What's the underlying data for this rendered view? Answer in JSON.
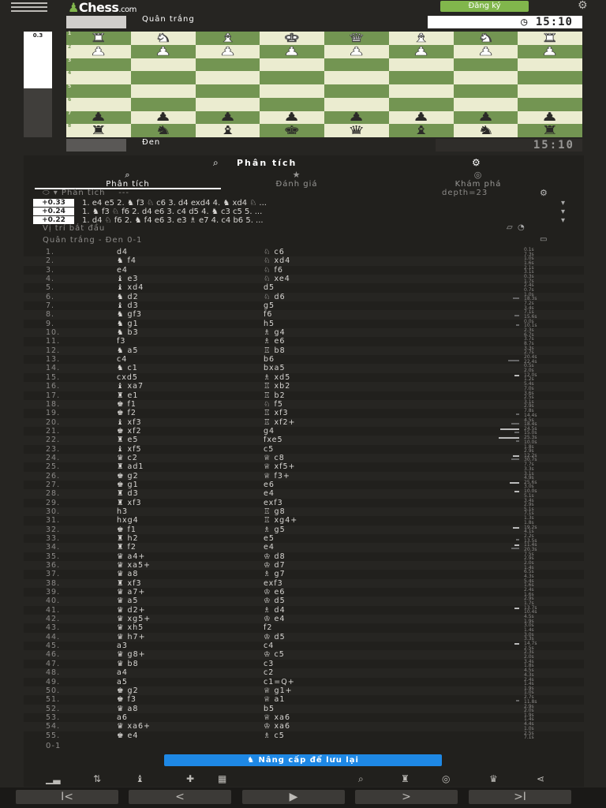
{
  "brand": {
    "logo": "Chess",
    "logo_suffix": ".com",
    "signup": "Đăng ký"
  },
  "eval_bar": {
    "value": "0.3",
    "white_fraction": 0.54
  },
  "players": {
    "top": {
      "name": "Quân trắng",
      "clock": "15:10"
    },
    "bottom": {
      "name": "Đen",
      "clock": "15:10"
    }
  },
  "board": {
    "ranks": [
      "1",
      "2",
      "3",
      "4",
      "5",
      "6",
      "7",
      "8"
    ],
    "rows": [
      [
        [
          "r",
          "w"
        ],
        [
          "n",
          "w"
        ],
        [
          "b",
          "w"
        ],
        [
          "k",
          "w"
        ],
        [
          "q",
          "w"
        ],
        [
          "b",
          "w"
        ],
        [
          "n",
          "w"
        ],
        [
          "r",
          "w"
        ]
      ],
      [
        [
          "p",
          "w"
        ],
        [
          "p",
          "w"
        ],
        [
          "p",
          "w"
        ],
        [
          "p",
          "w"
        ],
        [
          "p",
          "w"
        ],
        [
          "p",
          "w"
        ],
        [
          "p",
          "w"
        ],
        [
          "p",
          "w"
        ]
      ],
      [
        null,
        null,
        null,
        null,
        null,
        null,
        null,
        null
      ],
      [
        null,
        null,
        null,
        null,
        null,
        null,
        null,
        null
      ],
      [
        null,
        null,
        null,
        null,
        null,
        null,
        null,
        null
      ],
      [
        null,
        null,
        null,
        null,
        null,
        null,
        null,
        null
      ],
      [
        [
          "p",
          "b"
        ],
        [
          "p",
          "b"
        ],
        [
          "p",
          "b"
        ],
        [
          "p",
          "b"
        ],
        [
          "p",
          "b"
        ],
        [
          "p",
          "b"
        ],
        [
          "p",
          "b"
        ],
        [
          "p",
          "b"
        ]
      ],
      [
        [
          "r",
          "b"
        ],
        [
          "n",
          "b"
        ],
        [
          "b",
          "b"
        ],
        [
          "k",
          "b"
        ],
        [
          "q",
          "b"
        ],
        [
          "b",
          "b"
        ],
        [
          "n",
          "b"
        ],
        [
          "r",
          "b"
        ]
      ]
    ]
  },
  "panel": {
    "title": "Phân tích",
    "tabs": [
      {
        "label": "Phân tích",
        "icon": "⌕"
      },
      {
        "label": "Đánh giá",
        "icon": "★"
      },
      {
        "label": "Khám phá",
        "icon": "◎"
      }
    ],
    "analysis_label": "Phân tích",
    "analysis_extra": "---",
    "depth": "depth=23",
    "lines": [
      {
        "eval": "+0.33",
        "text": "1. e4 e5 2. ♞ f3 ♘ c6 3. d4 exd4 4. ♞ xd4 ♘ ..."
      },
      {
        "eval": "+0.24",
        "text": "1. ♞ f3 ♘ f6 2. d4 e6 3. c4 d5 4. ♞ c3 c5 5. ..."
      },
      {
        "eval": "+0.22",
        "text": "1. d4 ♘ f6 2. ♞ f4 e6 3. e3 ♗ e7 4. c4 b6 5. ..."
      }
    ],
    "start_position": "Vị trí bắt đầu",
    "game_header": "Quân trắng - Đen 0-1",
    "result": "0-1",
    "upgrade": "Nâng cấp để lưu lại"
  },
  "moves": [
    {
      "n": "1.",
      "w": "d4",
      "b": "♘ c6",
      "t1": "0.1s",
      "t2": "7.3s",
      "bw": 0,
      "bb": 0
    },
    {
      "n": "2.",
      "w": "♞ f4",
      "b": "♘ xd4",
      "t1": "1.0s",
      "t2": "1.6s",
      "bw": 0,
      "bb": 0
    },
    {
      "n": "3.",
      "w": "e4",
      "b": "♘ f6",
      "t1": "2.1s",
      "t2": "3.1s",
      "bw": 0,
      "bb": 0
    },
    {
      "n": "4.",
      "w": "♝ e3",
      "b": "♘ xe4",
      "t1": "0.3s",
      "t2": "1.7s",
      "bw": 0,
      "bb": 0
    },
    {
      "n": "5.",
      "w": "♝ xd4",
      "b": "d5",
      "t1": "2.4s",
      "t2": "0.7s",
      "bw": 0,
      "bb": 0
    },
    {
      "n": "6.",
      "w": "♞ d2",
      "b": "♘ d6",
      "t1": "1.0s",
      "t2": "18.3s",
      "bw": 0,
      "bb": 8
    },
    {
      "n": "7.",
      "w": "♝ d3",
      "b": "g5",
      "t1": "7.2s",
      "t2": "3.4s",
      "bw": 0,
      "bb": 0
    },
    {
      "n": "8.",
      "w": "♞ gf3",
      "b": "f6",
      "t1": "7.1s",
      "t2": "15.6s",
      "bw": 0,
      "bb": 6
    },
    {
      "n": "9.",
      "w": "♞ g1",
      "b": "h5",
      "t1": "0.0s",
      "t2": "10.1s",
      "bw": 0,
      "bb": 4
    },
    {
      "n": "10.",
      "w": "♞ b3",
      "b": "♗ g4",
      "t1": "2.3s",
      "t2": "6.7s",
      "bw": 0,
      "bb": 0
    },
    {
      "n": "11.",
      "w": "f3",
      "b": "♗ e6",
      "t1": "3.7s",
      "t2": "8.7s",
      "bw": 0,
      "bb": 0
    },
    {
      "n": "12.",
      "w": "♞ a5",
      "b": "♖ b8",
      "t1": "3.3s",
      "t2": "2.7s",
      "bw": 0,
      "bb": 0
    },
    {
      "n": "13.",
      "w": "c4",
      "b": "b6",
      "t1": "20.4s",
      "t2": "22.4s",
      "bw": 0,
      "bb": 14
    },
    {
      "n": "14.",
      "w": "♞ c1",
      "b": "bxa5",
      "t1": "0.5s",
      "t2": "2.0s",
      "bw": 0,
      "bb": 0
    },
    {
      "n": "15.",
      "w": "cxd5",
      "b": "♗ xd5",
      "t1": "12.0s",
      "t2": "1.2s",
      "bw": 6,
      "bb": 0
    },
    {
      "n": "16.",
      "w": "♝ xa7",
      "b": "♖ xb2",
      "t1": "5.4s",
      "t2": "7.0s",
      "bw": 0,
      "bb": 0
    },
    {
      "n": "17.",
      "w": "♜ e1",
      "b": "♖ b2",
      "t1": "3.6s",
      "t2": "2.5s",
      "bw": 0,
      "bb": 0
    },
    {
      "n": "18.",
      "w": "♚ f1",
      "b": "♘ f5",
      "t1": "3.1s",
      "t2": "2.9s",
      "bw": 0,
      "bb": 0
    },
    {
      "n": "19.",
      "w": "♚ f2",
      "b": "♖ xf3",
      "t1": "7.8s",
      "t2": "14.4s",
      "bw": 0,
      "bb": 4
    },
    {
      "n": "20.",
      "w": "♝ xf3",
      "b": "♖ xf2+",
      "t1": "4.5s",
      "t2": "18.4s",
      "bw": 0,
      "bb": 10
    },
    {
      "n": "21.",
      "w": "♚ xf2",
      "b": "g4",
      "t1": "24.5s",
      "t2": "15.0s",
      "bw": 24,
      "bb": 6
    },
    {
      "n": "22.",
      "w": "♜ e5",
      "b": "fxe5",
      "t1": "25.3s",
      "t2": "10.0s",
      "bw": 26,
      "bb": 4
    },
    {
      "n": "23.",
      "w": "♝ xf5",
      "b": "c5",
      "t1": "1.8s",
      "t2": "2.9s",
      "bw": 0,
      "bb": 0
    },
    {
      "n": "24.",
      "w": "♛ c2",
      "b": "♕ c8",
      "t1": "12.2s",
      "t2": "30.7s",
      "bw": 8,
      "bb": 10
    },
    {
      "n": "25.",
      "w": "♜ ad1",
      "b": "♕ xf5+",
      "t1": "7.7s",
      "t2": "3.3s",
      "bw": 0,
      "bb": 0
    },
    {
      "n": "26.",
      "w": "♚ g2",
      "b": "♕ f3+",
      "t1": "3.1s",
      "t2": "4.9s",
      "bw": 0,
      "bb": 0
    },
    {
      "n": "27.",
      "w": "♚ g1",
      "b": "e6",
      "t1": "25.6s",
      "t2": "3.0s",
      "bw": 12,
      "bb": 0
    },
    {
      "n": "28.",
      "w": "♜ d3",
      "b": "e4",
      "t1": "10.0s",
      "t2": "5.1s",
      "bw": 6,
      "bb": 0
    },
    {
      "n": "29.",
      "w": "♜ xf3",
      "b": "exf3",
      "t1": "3.4s",
      "t2": "2.9s",
      "bw": 0,
      "bb": 0
    },
    {
      "n": "30.",
      "w": "h3",
      "b": "♖ g8",
      "t1": "5.1s",
      "t2": "7.1s",
      "bw": 0,
      "bb": 0
    },
    {
      "n": "31.",
      "w": "hxg4",
      "b": "♖ xg4+",
      "t1": "1.3s",
      "t2": "1.8s",
      "bw": 0,
      "bb": 0
    },
    {
      "n": "32.",
      "w": "♚ f1",
      "b": "♗ g5",
      "t1": "19.2s",
      "t2": "4.1s",
      "bw": 8,
      "bb": 0
    },
    {
      "n": "33.",
      "w": "♜ h2",
      "b": "e5",
      "t1": "2.2s",
      "t2": "13.5s",
      "bw": 0,
      "bb": 4
    },
    {
      "n": "34.",
      "w": "♜ f2",
      "b": "e4",
      "t1": "11.4s",
      "t2": "20.3s",
      "bw": 6,
      "bb": 10
    },
    {
      "n": "35.",
      "w": "♛ a4+",
      "b": "♔ d8",
      "t1": "7.5s",
      "t2": "2.9s",
      "bw": 0,
      "bb": 0
    },
    {
      "n": "36.",
      "w": "♛ xa5+",
      "b": "♔ d7",
      "t1": "2.0s",
      "t2": "1.4s",
      "bw": 0,
      "bb": 0
    },
    {
      "n": "37.",
      "w": "♛ a8",
      "b": "♗ g7",
      "t1": "6.5s",
      "t2": "4.3s",
      "bw": 0,
      "bb": 0
    },
    {
      "n": "38.",
      "w": "♜ xf3",
      "b": "exf3",
      "t1": "5.4s",
      "t2": "1.6s",
      "bw": 0,
      "bb": 0
    },
    {
      "n": "39.",
      "w": "♛ a7+",
      "b": "♔ e6",
      "t1": "2.4s",
      "t2": "1.6s",
      "bw": 0,
      "bb": 0
    },
    {
      "n": "40.",
      "w": "♛ a5",
      "b": "♔ d5",
      "t1": "2.9s",
      "t2": "1.7s",
      "bw": 0,
      "bb": 0
    },
    {
      "n": "41.",
      "w": "♛ d2+",
      "b": "♗ d4",
      "t1": "13.7s",
      "t2": "10.4s",
      "bw": 6,
      "bb": 0
    },
    {
      "n": "42.",
      "w": "♛ xg5+",
      "b": "♔ e4",
      "t1": "4.5s",
      "t2": "1.9s",
      "bw": 0,
      "bb": 0
    },
    {
      "n": "43.",
      "w": "♛ xh5",
      "b": "f2",
      "t1": "3.0s",
      "t2": "1.4s",
      "bw": 0,
      "bb": 0
    },
    {
      "n": "44.",
      "w": "♛ h7+",
      "b": "♔ d5",
      "t1": "3.0s",
      "t2": "3.3s",
      "bw": 0,
      "bb": 0
    },
    {
      "n": "45.",
      "w": "a3",
      "b": "c4",
      "t1": "14.7s",
      "t2": "2.5s",
      "bw": 6,
      "bb": 0
    },
    {
      "n": "46.",
      "w": "♛ g8+",
      "b": "♔ c5",
      "t1": "2.3s",
      "t2": "2.0s",
      "bw": 0,
      "bb": 0
    },
    {
      "n": "47.",
      "w": "♛ b8",
      "b": "c3",
      "t1": "3.4s",
      "t2": "1.8s",
      "bw": 0,
      "bb": 0
    },
    {
      "n": "48.",
      "w": "a4",
      "b": "c2",
      "t1": "4.5s",
      "t2": "4.3s",
      "bw": 0,
      "bb": 0
    },
    {
      "n": "49.",
      "w": "a5",
      "b": "c1=Q+",
      "t1": "2.4s",
      "t2": "1.4s",
      "bw": 0,
      "bb": 0
    },
    {
      "n": "50.",
      "w": "♚ g2",
      "b": "♕ g1+",
      "t1": "1.9s",
      "t2": "1.0s",
      "bw": 0,
      "bb": 0
    },
    {
      "n": "51.",
      "w": "♚ f3",
      "b": "♕ a1",
      "t1": "2.7s",
      "t2": "11.8s",
      "bw": 0,
      "bb": 4
    },
    {
      "n": "52.",
      "w": "♛ a8",
      "b": "b5",
      "t1": "2.9s",
      "t2": "2.0s",
      "bw": 0,
      "bb": 0
    },
    {
      "n": "53.",
      "w": "a6",
      "b": "♕ xa6",
      "t1": "1.9s",
      "t2": "1.4s",
      "bw": 0,
      "bb": 0
    },
    {
      "n": "54.",
      "w": "♛ xa6+",
      "b": "♔ xa6",
      "t1": "4.4s",
      "t2": "1.0s",
      "bw": 0,
      "bb": 0
    },
    {
      "n": "55.",
      "w": "♚ e4",
      "b": "♗ c5",
      "t1": "2.5s",
      "t2": "7.1s",
      "bw": 0,
      "bb": 0
    }
  ],
  "toolbar": [
    "▁▃",
    "⇅",
    "♝",
    "✚",
    "▦",
    "⌕",
    "♜",
    "◎",
    "♛",
    "⋖"
  ],
  "nav": [
    "I<",
    "<",
    "▶",
    ">",
    ">I"
  ]
}
